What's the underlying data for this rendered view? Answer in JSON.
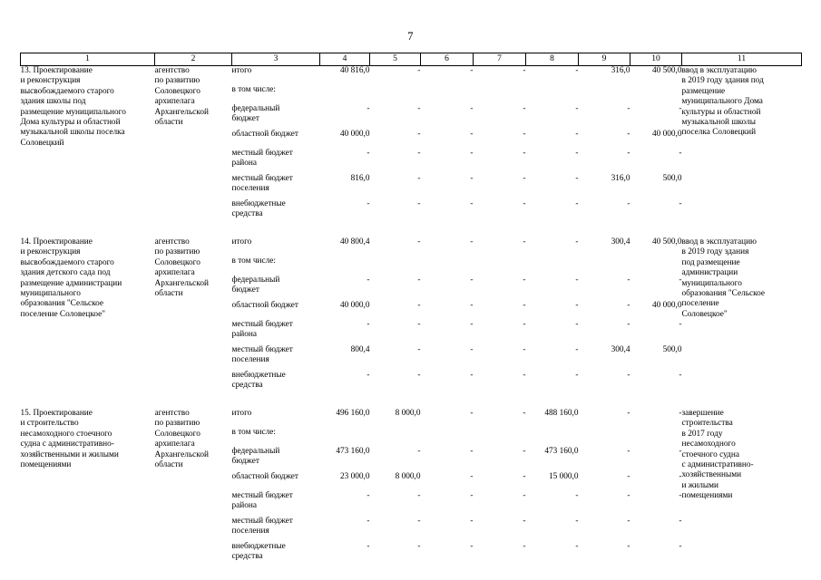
{
  "document": {
    "page_number": "7",
    "language": "ru"
  },
  "table": {
    "column_headers": [
      "1",
      "2",
      "3",
      "4",
      "5",
      "6",
      "7",
      "8",
      "9",
      "10",
      "11"
    ],
    "source_labels": [
      {
        "l1": "итого",
        "l2": ""
      },
      {
        "l1": "в том числе:",
        "l2": ""
      },
      {
        "l1": "федеральный",
        "l2": "бюджет"
      },
      {
        "l1": "областной бюджет",
        "l2": ""
      },
      {
        "l1": "местный бюджет",
        "l2": "района"
      },
      {
        "l1": "местный бюджет",
        "l2": "поселения"
      },
      {
        "l1": "внебюджетные",
        "l2": "средства"
      }
    ],
    "rows": [
      {
        "measure_lines": [
          "13. Проектирование",
          "и реконструкция",
          "высвобождаемого старого",
          "здания школы под",
          "размещение муниципального",
          "Дома культуры и областной",
          "музыкальной школы поселка",
          "Соловецкий"
        ],
        "executor_lines": [
          "агентство",
          "по развитию",
          "Соловецкого",
          "архипелага",
          "Архангельской",
          "области"
        ],
        "values": {
          "col4": [
            "40 816,0",
            "",
            "-",
            "40 000,0",
            "-",
            "816,0",
            "-"
          ],
          "col5": [
            "-",
            "",
            "-",
            "-",
            "-",
            "-",
            "-"
          ],
          "col6": [
            "-",
            "",
            "-",
            "-",
            "-",
            "-",
            "-"
          ],
          "col7": [
            "-",
            "",
            "-",
            "-",
            "-",
            "-",
            "-"
          ],
          "col8": [
            "-",
            "",
            "-",
            "-",
            "-",
            "-",
            "-"
          ],
          "col9": [
            "316,0",
            "",
            "-",
            "-",
            "-",
            "316,0",
            "-"
          ],
          "col10": [
            "40 500,0",
            "",
            "-",
            "40 000,0",
            "-",
            "500,0",
            "-"
          ]
        },
        "result_lines": [
          "ввод в эксплуатацию",
          "в 2019 году здания под",
          "размещение",
          "муниципального Дома",
          "культуры и областной",
          "музыкальной школы",
          "поселка Соловецкий"
        ]
      },
      {
        "measure_lines": [
          "14. Проектирование",
          "и реконструкция",
          "высвобождаемого старого",
          "здания детского сада под",
          "размещение администрации",
          "муниципального",
          "образования \"Сельское",
          "поселение Соловецкое\""
        ],
        "executor_lines": [
          "агентство",
          "по развитию",
          "Соловецкого",
          "архипелага",
          "Архангельской",
          "области"
        ],
        "values": {
          "col4": [
            "40 800,4",
            "",
            "-",
            "40 000,0",
            "-",
            "800,4",
            "-"
          ],
          "col5": [
            "-",
            "",
            "-",
            "-",
            "-",
            "-",
            "-"
          ],
          "col6": [
            "-",
            "",
            "-",
            "-",
            "-",
            "-",
            "-"
          ],
          "col7": [
            "-",
            "",
            "-",
            "-",
            "-",
            "-",
            "-"
          ],
          "col8": [
            "-",
            "",
            "-",
            "-",
            "-",
            "-",
            "-"
          ],
          "col9": [
            "300,4",
            "",
            "-",
            "-",
            "-",
            "300,4",
            "-"
          ],
          "col10": [
            "40 500,0",
            "",
            "-",
            "40 000,0",
            "-",
            "500,0",
            "-"
          ]
        },
        "result_lines": [
          "ввод в эксплуатацию",
          "в 2019 году здания",
          "под размещение",
          "администрации",
          "муниципального",
          "образования \"Сельское",
          "поселение",
          "Соловецкое\""
        ]
      },
      {
        "measure_lines": [
          "15. Проектирование",
          "и строительство",
          "несамоходного стоечного",
          "судна с административно-",
          "хозяйственными и жилыми",
          "помещениями"
        ],
        "executor_lines": [
          "агентство",
          "по развитию",
          "Соловецкого",
          "архипелага",
          "Архангельской",
          "области"
        ],
        "values": {
          "col4": [
            "496 160,0",
            "",
            "473 160,0",
            "23 000,0",
            "-",
            "-",
            "-"
          ],
          "col5": [
            "8 000,0",
            "",
            "-",
            "8 000,0",
            "-",
            "-",
            "-"
          ],
          "col6": [
            "-",
            "",
            "-",
            "-",
            "-",
            "-",
            "-"
          ],
          "col7": [
            "-",
            "",
            "-",
            "-",
            "-",
            "-",
            "-"
          ],
          "col8": [
            "488 160,0",
            "",
            "473 160,0",
            "15 000,0",
            "-",
            "-",
            "-"
          ],
          "col9": [
            "-",
            "",
            "-",
            "-",
            "-",
            "-",
            "-"
          ],
          "col10": [
            "-",
            "",
            "-",
            "-",
            "-",
            "-",
            "-"
          ]
        },
        "result_lines": [
          "завершение",
          "строительства",
          "в 2017 году",
          "несамоходного",
          "стоечного судна",
          "с административно-",
          "хозяйственными",
          "и жилыми",
          "помещениями"
        ]
      }
    ]
  }
}
